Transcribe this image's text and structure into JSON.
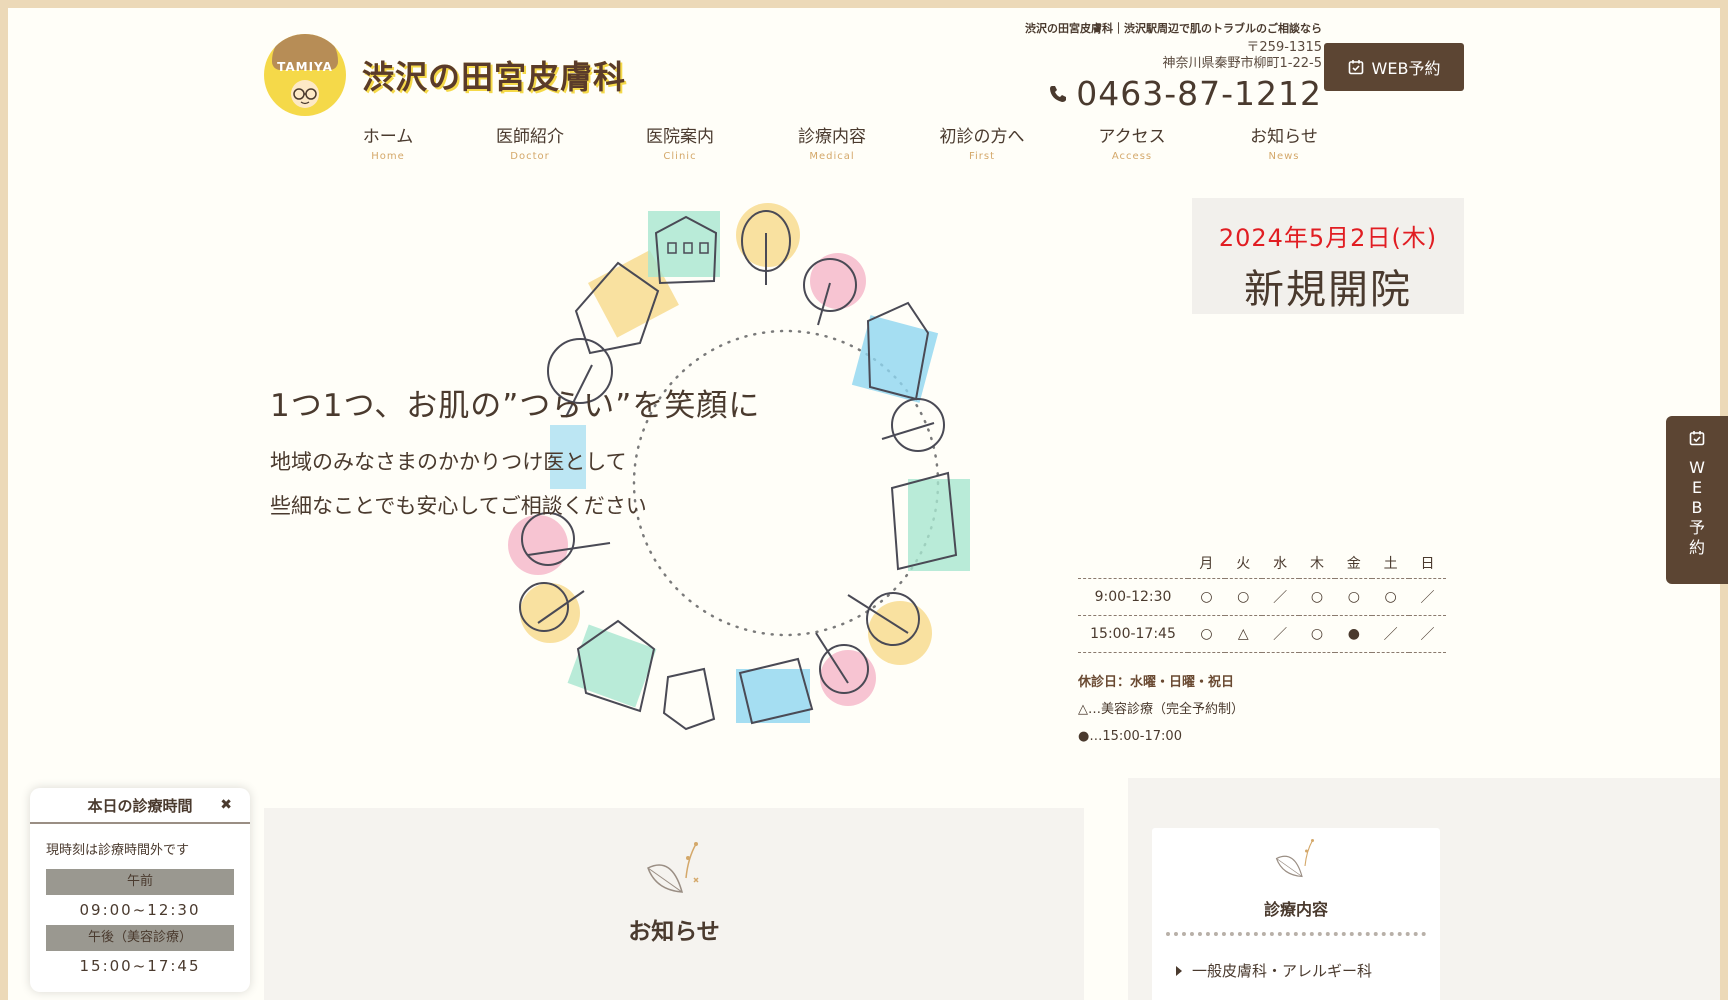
{
  "header": {
    "logo_badge": "TAMIYA",
    "logo_text": "渋沢の田宮皮膚科",
    "tagline": "渋沢の田宮皮膚科｜渋沢駅周辺で肌のトラブルのご相談なら",
    "postal": "〒259-1315",
    "address": "神奈川県秦野市柳町1-22-5",
    "phone": "0463-87-1212",
    "web_booking": "WEB予約"
  },
  "nav": [
    {
      "ja": "ホーム",
      "en": "Home"
    },
    {
      "ja": "医師紹介",
      "en": "Doctor"
    },
    {
      "ja": "医院案内",
      "en": "Clinic"
    },
    {
      "ja": "診療内容",
      "en": "Medical"
    },
    {
      "ja": "初診の方へ",
      "en": "First"
    },
    {
      "ja": "アクセス",
      "en": "Access"
    },
    {
      "ja": "お知らせ",
      "en": "News"
    }
  ],
  "hero": {
    "catch": "1つ1つ、お肌の”つらい”を笑顔に",
    "sub_line1": "地域のみなさまのかかりつけ医として",
    "sub_line2": "些細なことでも安心してご相談ください"
  },
  "opening": {
    "date": "2024年5月2日(木)",
    "title": "新規開院"
  },
  "schedule": {
    "days": [
      "月",
      "火",
      "水",
      "木",
      "金",
      "土",
      "日"
    ],
    "rows": [
      {
        "time": "9:00-12:30",
        "marks": [
          "○",
          "○",
          "／",
          "○",
          "○",
          "○",
          "／"
        ]
      },
      {
        "time": "15:00-17:45",
        "marks": [
          "○",
          "△",
          "／",
          "○",
          "●",
          "／",
          "／"
        ]
      }
    ],
    "holiday": "休診日：水曜・日曜・祝日",
    "note_triangle": "△…美容診療（完全予約制）",
    "note_dot": "●…15:00-17:00"
  },
  "side_tab": {
    "label": "WEB予約",
    "chars": [
      "W",
      "E",
      "B",
      "予",
      "約"
    ]
  },
  "news": {
    "title": "お知らせ"
  },
  "services": {
    "title": "診療内容",
    "items": [
      "一般皮膚科・アレルギー科"
    ]
  },
  "today": {
    "title": "本日の診療時間",
    "close": "✖",
    "status": "現時刻は診療時間外です",
    "am_label": "午前",
    "am_hours": "09:00~12:30",
    "pm_label": "午後（美容診療）",
    "pm_hours": "15:00~17:45"
  },
  "colors": {
    "accent": "#5c4533",
    "border": "#ecd9b8",
    "red": "#e11d22",
    "nav_en": "#d4a86a",
    "logo_yellow": "#f5d949"
  }
}
